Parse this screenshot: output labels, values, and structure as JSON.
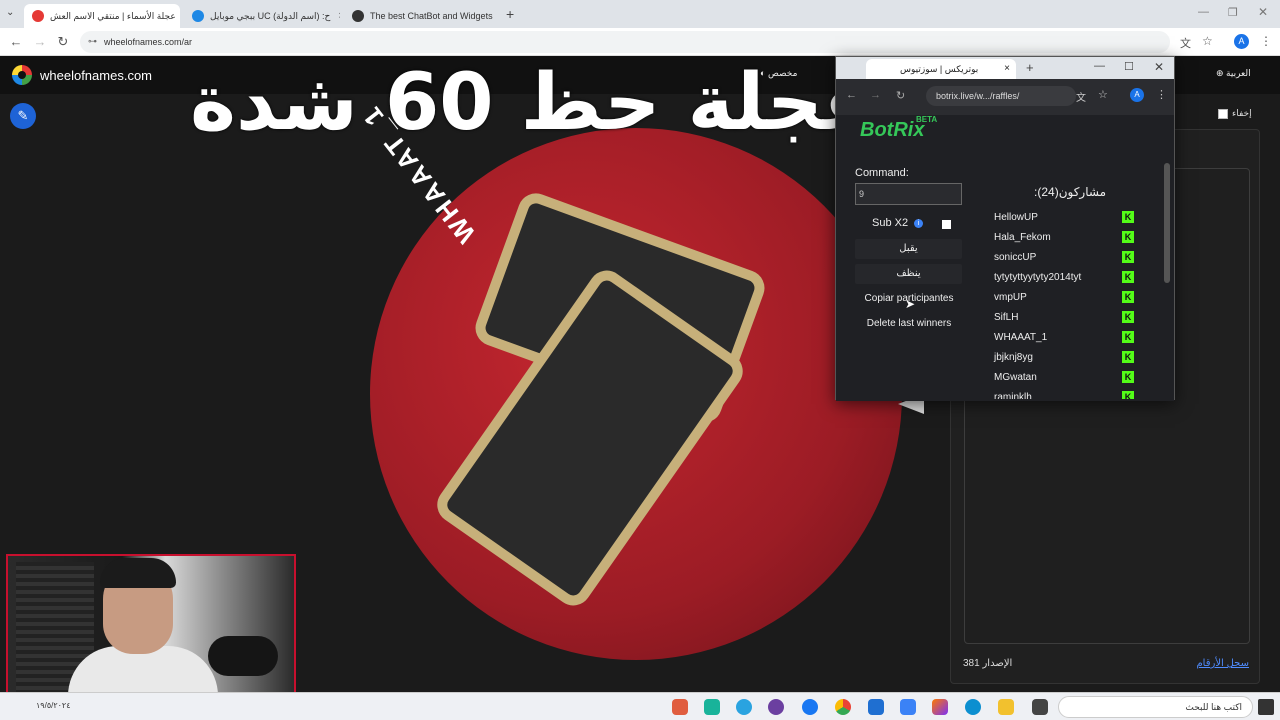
{
  "browser": {
    "tabs": [
      {
        "label": "عجلة الأسماء | منتقي الاسم العش",
        "active": true,
        "color": "#e53935"
      },
      {
        "label": "ببجي موبايل UC (اسم الدولة) :ح",
        "active": false,
        "color": "#1e88e5"
      },
      {
        "label": "The best ChatBot and Widgets",
        "active": false,
        "color": "#333333"
      }
    ],
    "new_tab": "+",
    "url": "wheelofnames.com/ar",
    "profile_initial": "A"
  },
  "page": {
    "site_name": "wheelofnames.com",
    "overlay_title": "عجلة حظ 60 شدة",
    "customize_label": "مخصص",
    "language_label": "العربية",
    "hide_label": "إخفاء",
    "wheel_label": "WHAAAT_1",
    "version_label": "الإصدار 381",
    "changelog_label": "سجل الأرقام"
  },
  "popup": {
    "tab_title": "بوتريكس | سوزتيوس",
    "url": "botrix.live/w.../raffles/",
    "logo": "BotRix",
    "logo_badge": "BETA",
    "command_label": "Command:",
    "command_value": "9",
    "subx2_label": "Sub X2",
    "subx2_info": "i",
    "accept_btn": "يقبل",
    "clean_btn": "ينظف",
    "copy_btn": "Copiar participantes",
    "delete_btn": "Delete last winners",
    "participants_title": "مشاركون(24):",
    "participants": [
      "HellowUP",
      "Hala_Fekom",
      "soniccUP",
      "tytytyttyytyty2014tyt",
      "vmpUP",
      "SifLH",
      "WHAAAT_1",
      "jbjknj8yg",
      "MGwatan",
      "ramjnklh"
    ],
    "platform_badge": "K",
    "platform_color": "#53fc18"
  },
  "taskbar": {
    "search_placeholder": "اكتب هنا للبحث",
    "date": "١٩/٥/٢٠٢٤"
  }
}
